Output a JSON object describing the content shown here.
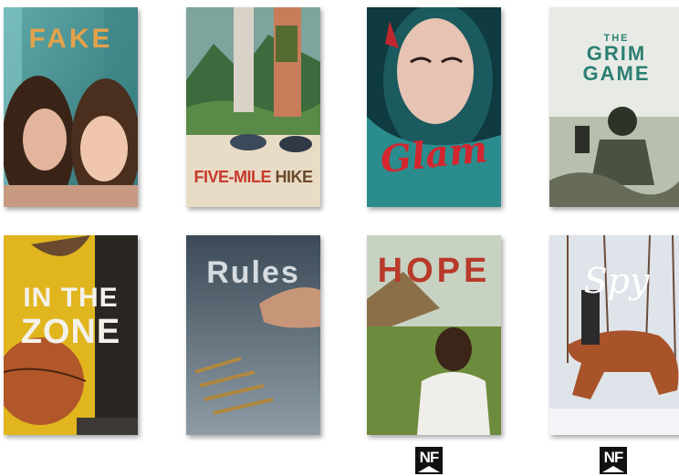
{
  "books": [
    {
      "title": "FAKE",
      "nonfiction": false
    },
    {
      "title": "FIVE-MILE HIKE",
      "title_part1": "FIVE-MILE",
      "title_part2": "HIKE",
      "nonfiction": false
    },
    {
      "title": "Glam",
      "nonfiction": false
    },
    {
      "title": "THE GRIM GAME",
      "title_line1": "THE",
      "title_line2": "GRIM",
      "title_line3": "GAME",
      "nonfiction": false
    },
    {
      "title": "IN THE ZONE",
      "title_line1": "IN THE",
      "title_line2": "ZONE",
      "nonfiction": false
    },
    {
      "title": "Rules",
      "nonfiction": false
    },
    {
      "title": "HOPE",
      "nonfiction": true
    },
    {
      "title": "Spy",
      "nonfiction": true
    }
  ],
  "badge": {
    "label": "NF",
    "icon": "nonfiction-badge-icon"
  }
}
